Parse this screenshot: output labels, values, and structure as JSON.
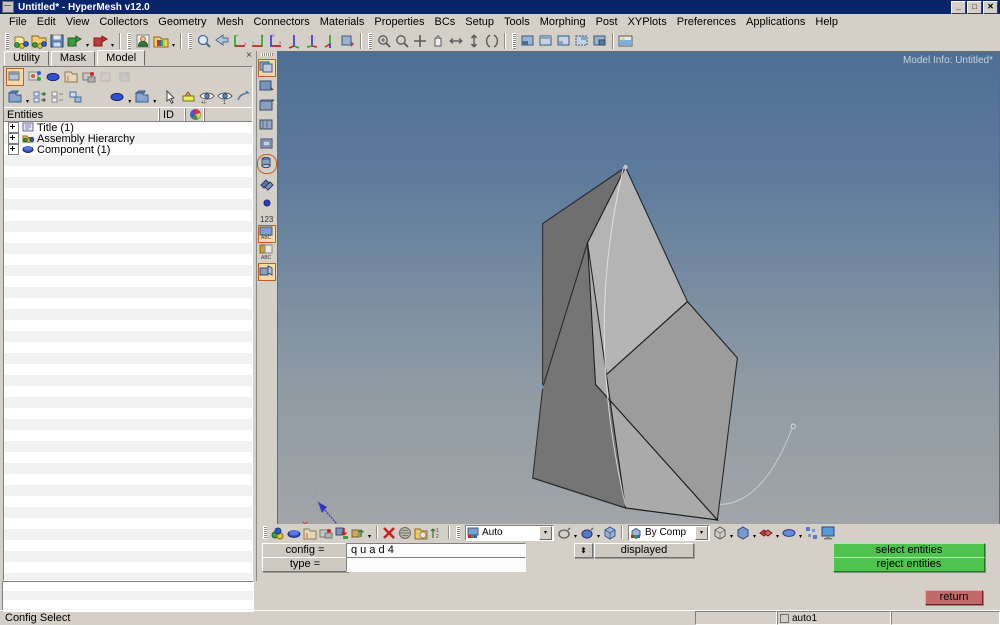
{
  "window": {
    "title": "Untitled* - HyperMesh v12.0",
    "app_icon": "window-icon",
    "minimize": "_",
    "maximize": "□",
    "close": "✕"
  },
  "menu": {
    "items": [
      "File",
      "Edit",
      "View",
      "Collectors",
      "Geometry",
      "Mesh",
      "Connectors",
      "Materials",
      "Properties",
      "BCs",
      "Setup",
      "Tools",
      "Morphing",
      "Post",
      "XYPlots",
      "Preferences",
      "Applications",
      "Help"
    ]
  },
  "toolbar": {
    "groups": [
      {
        "name": "file-group",
        "icons": [
          "new-model-icon",
          "open-model-icon",
          "save-model-icon",
          "import-icon",
          "export-icon"
        ]
      },
      {
        "name": "user-group",
        "icons": [
          "user-profile-icon",
          "color-palette-icon"
        ]
      },
      {
        "name": "view-group",
        "icons": [
          "zoom-fit-icon",
          "undo-view-icon",
          "view-xy-icon",
          "view-xz-icon",
          "view-yz-icon",
          "view-iso1-icon",
          "view-iso2-icon",
          "view-iso3-icon",
          "view-flip-icon"
        ]
      },
      {
        "name": "nav-group",
        "icons": [
          "zoom-window-icon",
          "zoom-icon",
          "rotate-center-icon",
          "pan-hand-icon",
          "arrow-lr-icon",
          "arrow-ud-icon",
          "rotate-icon"
        ]
      },
      {
        "name": "window-group",
        "icons": [
          "window-1-icon",
          "window-2-icon",
          "window-3-icon",
          "window-4-icon",
          "window-5-icon"
        ]
      },
      {
        "name": "capture-group",
        "icons": [
          "screen-capture-icon"
        ]
      }
    ]
  },
  "left_panel": {
    "tabs": [
      {
        "label": "Utility",
        "active": false
      },
      {
        "label": "Mask",
        "active": false
      },
      {
        "label": "Model",
        "active": true
      }
    ],
    "close_label": "×",
    "tool_row_1": [
      "model-browser-icon",
      "solver-browser-icon",
      "component-view-icon",
      "include-view-icon",
      "part-view-icon",
      "config-view-icon",
      "assembly-view-icon"
    ],
    "tool_row_2": [
      "folder-icon",
      "expand-all-icon",
      "collapse-all-icon",
      "sync-icon",
      "display-color-icon",
      "display-folder-icon",
      "pointer-icon",
      "isolate-icon",
      "show-icon",
      "show-only-icon",
      "reverse-icon"
    ],
    "columns": {
      "entities": "Entities",
      "id": "ID",
      "color": "color-wheel-icon"
    },
    "tree": [
      {
        "label": "Title (1)",
        "icon": "title-icon"
      },
      {
        "label": "Assembly Hierarchy",
        "icon": "assembly-icon"
      },
      {
        "label": "Component (1)",
        "icon": "component-icon"
      }
    ]
  },
  "vertical_toolbar": {
    "icons": [
      "page-1-icon",
      "page-2-icon",
      "page-3-icon",
      "page-4-icon",
      "page-5-icon",
      "page-cyl-icon",
      "page-stack-icon",
      "node-dot-icon",
      "number-123-icon",
      "abc-text-1-icon",
      "abc-text-2-icon",
      "page-last-icon"
    ],
    "label_123": "123",
    "label_abc_1": "ABC",
    "label_abc_2": "ABC"
  },
  "graphics": {
    "model_info": "Model Info: Untitled*",
    "axis": {
      "x": "X",
      "y": "Y",
      "z": "Z",
      "x_color": "#cc2222",
      "y_color": "#22bb22",
      "z_color": "#3333cc"
    },
    "background_top": "#4e6f94",
    "background_bottom": "#a9a9a9"
  },
  "command_panel": {
    "toolbar_icons": [
      "components-icon",
      "component-blue-icon",
      "include-icon",
      "assembly-icon2",
      "load-down-icon",
      "load-up-icon",
      "delete-red-icon",
      "mask-icon",
      "organize-icon",
      "renumber-icon"
    ],
    "mode_combo": {
      "value": "Auto",
      "icon": "auto-icon"
    },
    "shape_icons": [
      "lasso-icon",
      "polygon-icon",
      "box-select-icon"
    ],
    "color_combo": {
      "value": "By Comp",
      "icon": "by-comp-icon"
    },
    "render_icons": [
      "wireframe-icon",
      "shaded-icon",
      "feature-line-icon",
      "transparent-icon",
      "mesh-lines-icon",
      "monitor-icon"
    ],
    "fields": [
      {
        "label": "config =",
        "value": "q u a d 4"
      },
      {
        "label": "type  =",
        "value": ""
      }
    ],
    "spinner": "⬍",
    "displayed_button": "displayed",
    "action_buttons": [
      {
        "label": "select entities",
        "color": "#4ec44e"
      },
      {
        "label": "reject entities",
        "color": "#4ec44e"
      }
    ],
    "return_button": {
      "label": "return",
      "color": "#c26a6a"
    }
  },
  "status_bar": {
    "message": "Config Select",
    "cells": [
      {
        "text": "",
        "icon": null
      },
      {
        "text": "auto1",
        "icon": "checkbox-icon"
      },
      {
        "text": "",
        "icon": null
      }
    ]
  }
}
